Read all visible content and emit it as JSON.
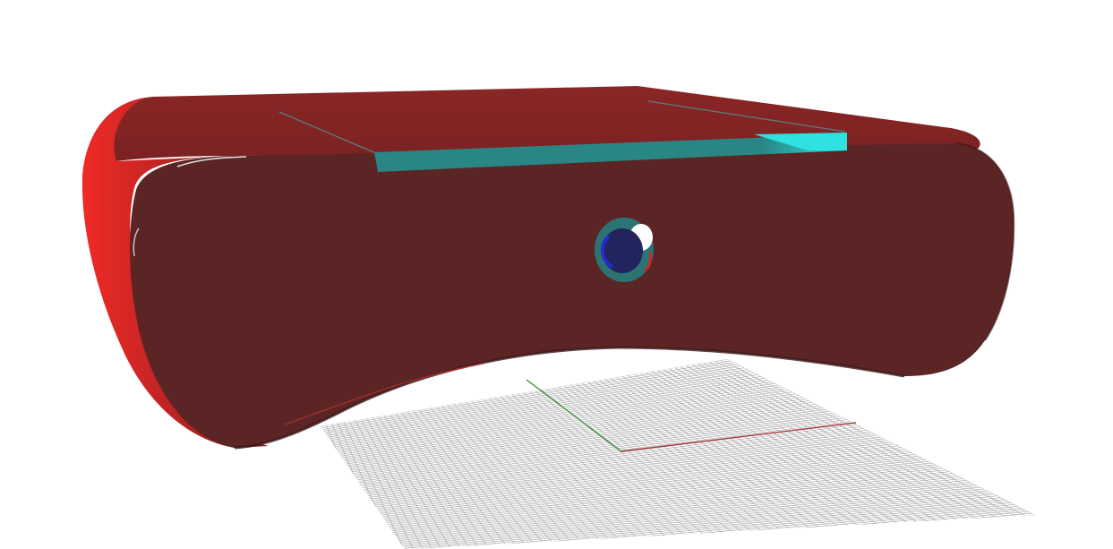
{
  "viewport": {
    "background": "#ffffff",
    "projection": "perspective"
  },
  "model": {
    "shape": "rounded enclosure with concave bottom edge",
    "colors": {
      "top": "#8a2626",
      "front": "#5b2525",
      "side_highlight": "#f02a26",
      "side_mid": "#c02424",
      "side_dark": "#7e1d1d",
      "top_edge_highlight": "#ffffff"
    }
  },
  "lid_insert": {
    "colors": {
      "face": "#2a8585",
      "highlight": "#2ee2e2",
      "groove_line": "#5d7d7d"
    }
  },
  "front_port": {
    "icon": "round-port-icon",
    "colors": {
      "rim": "#2c7474",
      "inner": "#22245e",
      "accent": "#2929d0",
      "glint": "#ffffff",
      "red_hint": "#c92727"
    }
  },
  "ground_grid": {
    "visible": true,
    "color": "#8c8c8c"
  },
  "axes": {
    "x_color": "#a23a3a",
    "y_color": "#2f8a2f"
  }
}
